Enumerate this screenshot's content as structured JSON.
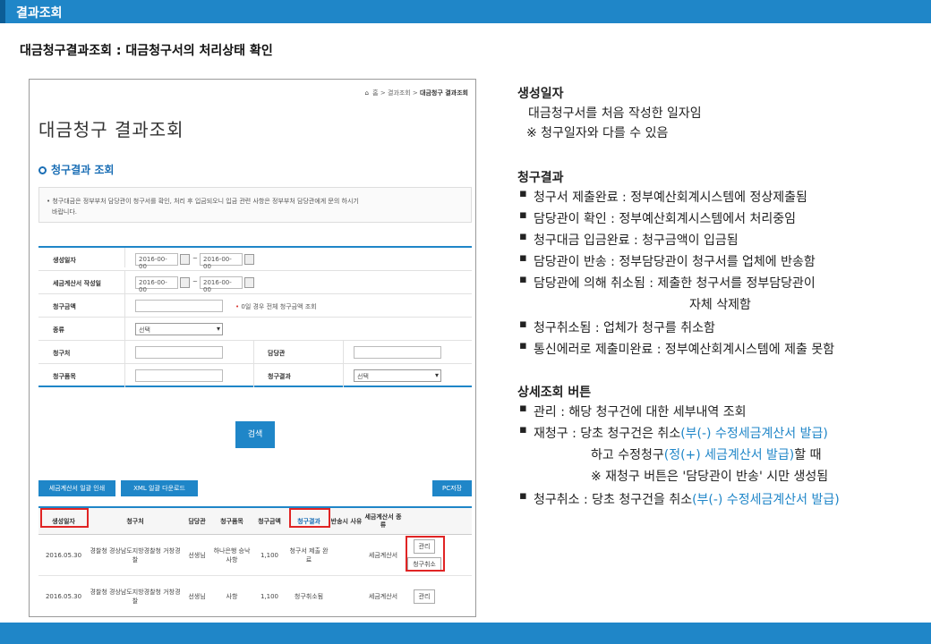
{
  "header": {
    "title": "결과조회"
  },
  "section_heading": "대금청구결과조회 : 대금청구서의 처리상태 확인",
  "screenshot": {
    "breadcrumb": {
      "home": "홈",
      "level1": "결과조회",
      "current": "대금청구 결과조회"
    },
    "page_title": "대금청구 결과조회",
    "subheading": "청구결과 조회",
    "notice_line1": "• 청구대금은 정부부처 담당관이 청구서를 확인, 처리 후 입금되오니 입금 관련 사항은 정부부처 담당관에게 문의 하시기",
    "notice_line2": "바랍니다.",
    "form": {
      "created_date_label": "생성일자",
      "invoice_date_label": "세금계산서 작성일",
      "amount_label": "청구금액",
      "type_label": "종류",
      "claim_dest_label": "청구처",
      "manager_label": "담당관",
      "item_label": "청구품목",
      "result_label": "청구결과",
      "date_value": "2016-00-00",
      "tilde": "~",
      "amount_note_star": "•",
      "amount_note": "0일 경우 전체 청구금액 조회",
      "select_default": "선택"
    },
    "search_button": "검색",
    "buttons": {
      "print_invoice": "세금계산서 일괄 인쇄",
      "xml_download": "XML 일괄 다운로드",
      "pc_save": "PC저장"
    },
    "table": {
      "headers": [
        "생성일자",
        "청구처",
        "담당관",
        "청구품목",
        "청구금액",
        "청구결과",
        "반송시 사유",
        "세금계산서 종류",
        ""
      ],
      "rows": [
        {
          "date": "2016.05.30",
          "dest": "경찰청 경상남도지방경찰청 거창경찰",
          "manager": "선생님",
          "item": "하나은행 승낙사항",
          "amount": "1,100",
          "result": "청구서 제출 완료",
          "reason": "",
          "invoice_type": "세금계산서",
          "actions": [
            "관리",
            "청구취소"
          ]
        },
        {
          "date": "2016.05.30",
          "dest": "경찰청 경상남도지방경찰청 거창경찰",
          "manager": "선생님",
          "item": "사항",
          "amount": "1,100",
          "result": "청구취소됨",
          "reason": "",
          "invoice_type": "세금계산서",
          "actions": [
            "관리"
          ]
        }
      ]
    }
  },
  "explanation": {
    "created_title": "생성일자",
    "created_desc1": "대금청구서를 처음 작성한 일자임",
    "created_desc2": "※ 청구일자와 다를 수 있음",
    "result_title": "청구결과",
    "result_items": [
      "청구서 제출완료 : 정부예산회계시스템에 정상제출됨",
      "담당관이 확인 : 정부예산회계시스템에서 처리중임",
      "청구대금 입금완료 : 청구금액이 입금됨",
      "담당관이 반송 : 정부담당관이 청구서를 업체에 반송함",
      "담당관에 의해 취소됨 : 제출한 청구서를 정부담당관이",
      "자체 삭제함",
      "청구취소됨 : 업체가 청구를 취소함",
      "통신에러로 제출미완료 : 정부예산회계시스템에 제출 못함"
    ],
    "detail_title": "상세조회 버튼",
    "detail_manage": "관리 : 해당 청구건에 대한 세부내역 조회",
    "detail_reclaim_a": "재청구 : 당초 청구건은 취소",
    "detail_reclaim_a_blue": "(부(-) 수정세금계산서 발급)",
    "detail_reclaim_b": "하고 수정청구",
    "detail_reclaim_b_blue": "(정(+) 세금계산서 발급)",
    "detail_reclaim_b_end": "할 때",
    "detail_reclaim_c": "※ 재청구 버튼은 '담당관이 반송' 시만 생성됨",
    "detail_cancel_a": "청구취소 : 당초 청구건을 취소",
    "detail_cancel_a_blue": "(부(-) 수정세금계산서 발급)"
  }
}
